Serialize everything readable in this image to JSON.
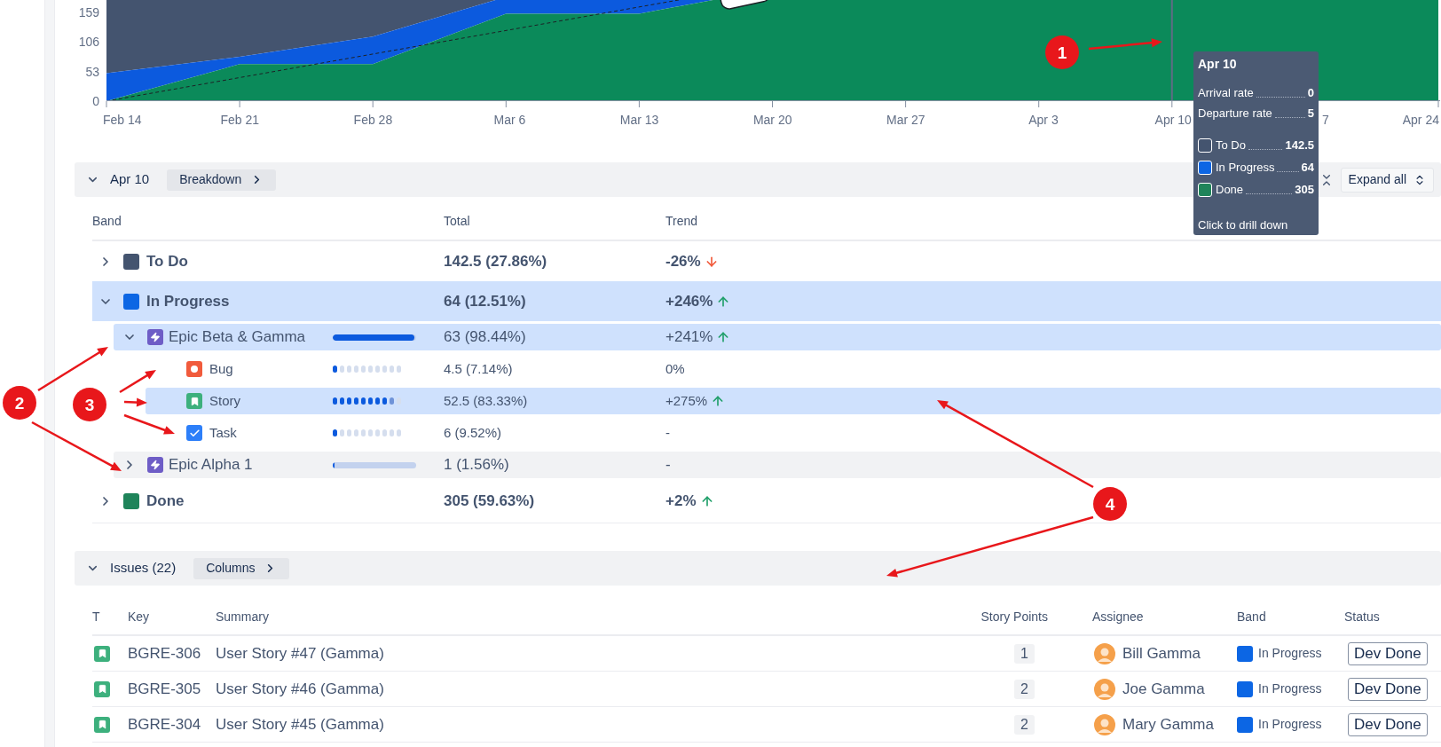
{
  "chart": {
    "y_axis_labels": [
      "159",
      "106",
      "53",
      "0"
    ],
    "x_axis_labels": [
      "Feb 14",
      "Feb 21",
      "Feb 28",
      "Mar 6",
      "Mar 13",
      "Mar 20",
      "Mar 27",
      "Apr 3",
      "Apr 10",
      "7",
      "Apr 24"
    ]
  },
  "tooltip": {
    "title": "Apr 10",
    "rates": [
      {
        "label": "Arrival rate",
        "value": "0"
      },
      {
        "label": "Departure rate",
        "value": "5"
      }
    ],
    "bands": [
      {
        "label": "To Do",
        "value": "142.5",
        "color": "#44546f"
      },
      {
        "label": "In Progress",
        "value": "64",
        "color": "#0c66e4"
      },
      {
        "label": "Done",
        "value": "305",
        "color": "#1f845a"
      }
    ],
    "hint": "Click to drill down"
  },
  "breakdown_bar": {
    "expanded": true,
    "title": "Apr 10",
    "button": "Breakdown",
    "expand_all": "Expand all"
  },
  "breakdown_table": {
    "columns": [
      "Band",
      "Total",
      "Trend"
    ],
    "rows": [
      {
        "kind": "band",
        "label": "To Do",
        "color": "#44546f",
        "expanded": false,
        "selected": false,
        "hovered": false,
        "total": "142.5 (27.86%)",
        "trend": "-26%",
        "up": false,
        "down": true
      },
      {
        "kind": "band",
        "label": "In Progress",
        "color": "#0c66e4",
        "expanded": true,
        "selected": true,
        "hovered": false,
        "total": "64 (12.51%)",
        "trend": "+246%",
        "up": true,
        "down": false,
        "children": [
          {
            "kind": "epic",
            "label": "Epic Beta & Gamma",
            "expanded": true,
            "selected": true,
            "hovered": false,
            "level": 0.98,
            "total": "63 (98.44%)",
            "trend": "+241%",
            "up": true,
            "down": false,
            "children": [
              {
                "kind": "bug",
                "label": "Bug",
                "selected": false,
                "hovered": false,
                "level": 0.07,
                "total": "4.5 (7.14%)",
                "trend": "0%",
                "up": false,
                "down": false
              },
              {
                "kind": "story",
                "label": "Story",
                "selected": true,
                "hovered": false,
                "level": 0.83,
                "total": "52.5 (83.33%)",
                "trend": "+275%",
                "up": true,
                "down": false
              },
              {
                "kind": "task",
                "label": "Task",
                "selected": false,
                "hovered": false,
                "level": 0.1,
                "total": "6 (9.52%)",
                "trend": "-",
                "up": false,
                "down": false
              }
            ]
          },
          {
            "kind": "epic",
            "label": "Epic Alpha 1",
            "expanded": false,
            "selected": false,
            "hovered": true,
            "level": 0.016,
            "total": "1 (1.56%)",
            "trend": "-",
            "up": false,
            "down": false
          }
        ]
      },
      {
        "kind": "band",
        "label": "Done",
        "color": "#1f845a",
        "expanded": false,
        "selected": false,
        "hovered": false,
        "total": "305 (59.63%)",
        "trend": "+2%",
        "up": true,
        "down": false
      }
    ]
  },
  "issues_bar": {
    "expanded": true,
    "title": "Issues (22)",
    "button": "Columns"
  },
  "issues_table": {
    "columns": [
      "T",
      "Key",
      "Summary",
      "Story Points",
      "Assignee",
      "Band",
      "Status"
    ],
    "rows": [
      {
        "kind": "story",
        "key": "BGRE-306",
        "summary": "User Story #47 (Gamma)",
        "points": "1",
        "assignee": "Bill Gamma",
        "band": "In Progress",
        "color": "#0c66e4",
        "status": "Dev Done"
      },
      {
        "kind": "story",
        "key": "BGRE-305",
        "summary": "User Story #46 (Gamma)",
        "points": "2",
        "assignee": "Joe Gamma",
        "band": "In Progress",
        "color": "#0c66e4",
        "status": "Dev Done"
      },
      {
        "kind": "story",
        "key": "BGRE-304",
        "summary": "User Story #45 (Gamma)",
        "points": "2",
        "assignee": "Mary Gamma",
        "band": "In Progress",
        "color": "#0c66e4",
        "status": "Dev Done"
      }
    ]
  },
  "callouts": [
    {
      "label": "1"
    },
    {
      "label": "2"
    },
    {
      "label": "3"
    },
    {
      "label": "4"
    }
  ]
}
